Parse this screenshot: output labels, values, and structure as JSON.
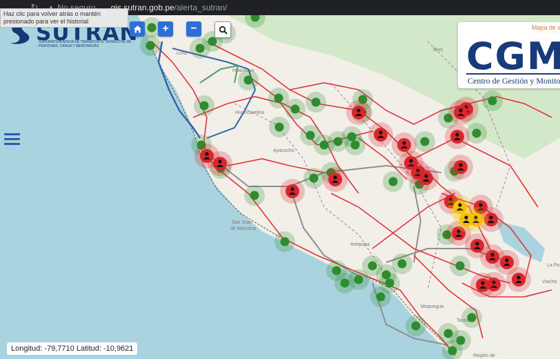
{
  "browser": {
    "security_label": "No seguro",
    "url_host": "gis.sutran.gob.pe",
    "url_path": "/alerta_sutran/",
    "back_tooltip": "Haz clic para volver atrás o mantén presionado para ver el historial"
  },
  "logo": {
    "name": "SUTRAN",
    "subtitle": "SUPERINTENDENCIA DE TRANSPORTE TERRESTRE DE PERSONAS, CARGA Y MERCANCÍAS"
  },
  "toolbar": {
    "home_icon": "home-icon",
    "zoom_in_label": "+",
    "zoom_out_label": "−",
    "search_icon": "search-icon"
  },
  "menu_icon": "hamburger-menu-icon",
  "cgm": {
    "mapa_label": "Mapa de a",
    "logo_text": "CGM",
    "subtitle": "Centro de Gestión y Monitoreo"
  },
  "coords": {
    "lon_label": "Longitud:",
    "lon_value": "-79,7710",
    "lat_label": "Latitud:",
    "lat_value": "-10,9621"
  },
  "place_labels": {
    "lima": "Lima",
    "huancayo": "Huancayo",
    "huancavelica": "Huancavelica",
    "ayacucho": "Ayacucho",
    "san_juan": "San Juan",
    "marcona": "de Marcona",
    "arequipa": "Arequipa",
    "moquegua": "Moquegua",
    "tacna": "Tacna",
    "dios": "Dios",
    "la_paz": "La Pa",
    "viacha": "Viacha",
    "region": "Región de"
  },
  "colors": {
    "sea": "#a9d3df",
    "land": "#f2efe9",
    "jungle": "#cde6c2",
    "road_red": "#e0343b",
    "road_gray": "#8f8f8f",
    "marker_green": "#2e8b2e",
    "marker_red": "#d9252c",
    "marker_yellow": "#f6c200"
  }
}
